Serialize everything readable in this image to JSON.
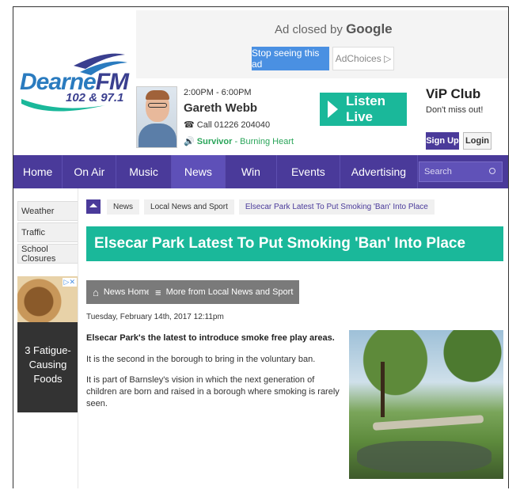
{
  "ad": {
    "closed_prefix": "Ad closed by",
    "closed_brand": "Google",
    "stop_label": "Stop seeing this ad",
    "choices_label": "AdChoices ▷"
  },
  "logo": {
    "dearne": "Dearne",
    "fm": "FM",
    "freq": "102 & 97.1"
  },
  "show": {
    "time": "2:00PM - 6:00PM",
    "presenter": "Gareth Webb",
    "phone": "Call 01226 204040",
    "now_playing_artist": "Survivor",
    "now_playing_track": " - Burning Heart"
  },
  "listen": {
    "label": "Listen Live"
  },
  "vip": {
    "title": "ViP Club",
    "subtitle": "Don't miss out!",
    "signup": "Sign Up",
    "login": "Login"
  },
  "nav": {
    "items": [
      "Home",
      "On Air",
      "Music",
      "News",
      "Win",
      "Events",
      "Advertising"
    ],
    "active": "News",
    "search_placeholder": "Search"
  },
  "sidebar": {
    "links": [
      "Weather",
      "Traffic",
      "School Closures"
    ],
    "ad_text": "3 Fatigue-Causing Foods"
  },
  "breadcrumb": [
    "News",
    "Local News and Sport",
    "Elsecar Park Latest To Put Smoking 'Ban' Into Place"
  ],
  "article": {
    "title": "Elsecar Park Latest To Put Smoking 'Ban' Into Place",
    "news_home": "News Home",
    "more_from": "More from Local News and Sport",
    "date": "Tuesday, February 14th, 2017 12:11pm",
    "lead": "Elsecar Park's the latest to introduce smoke free play areas.",
    "paragraphs": [
      "It is the second in the borough to bring in the voluntary ban.",
      "It is part of Barnsley's vision in which the next generation of children are born and raised in a borough where smoking is rarely seen."
    ]
  },
  "colors": {
    "purple": "#4a3a9a",
    "teal": "#1ab89a",
    "blue": "#4a90e2"
  }
}
